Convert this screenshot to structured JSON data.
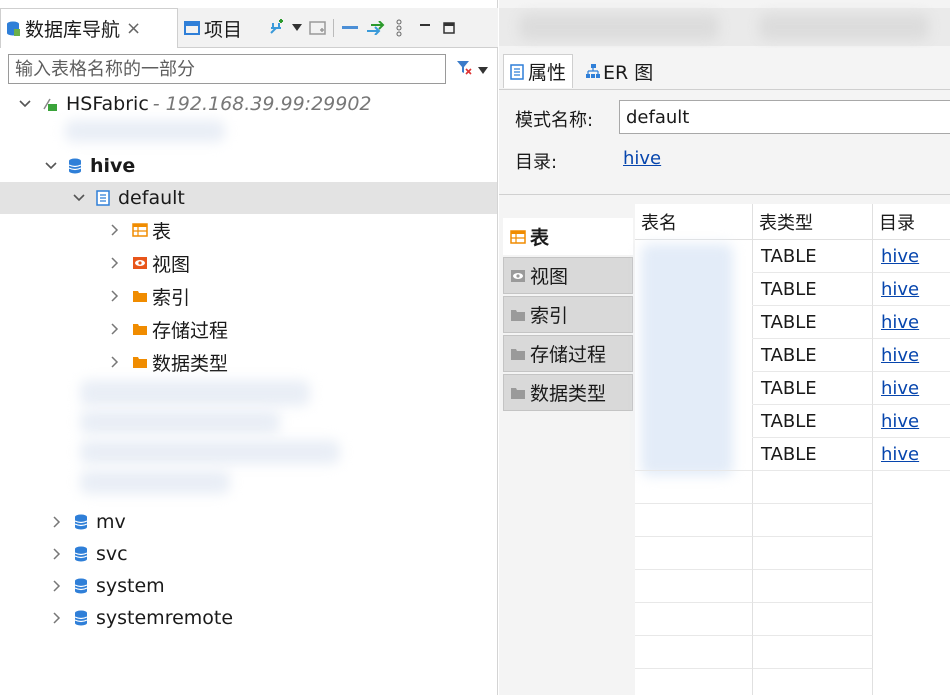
{
  "left_panel": {
    "tabs": [
      {
        "label": "数据库导航",
        "close": "×"
      },
      {
        "label": "项目"
      }
    ],
    "filter": {
      "placeholder": "输入表格名称的一部分"
    },
    "tree": {
      "connection": {
        "name": "HSFabric",
        "detail": " - 192.168.39.99:29902"
      },
      "database": "hive",
      "schema": "default",
      "folders": [
        "表",
        "视图",
        "索引",
        "存储过程",
        "数据类型"
      ],
      "other_databases": [
        "mv",
        "svc",
        "system",
        "systemremote"
      ]
    }
  },
  "right_panel": {
    "tabs": [
      {
        "label": "属性"
      },
      {
        "label": "ER 图"
      }
    ],
    "properties": {
      "schema_label": "模式名称:",
      "schema_value": "default",
      "catalog_label": "目录:",
      "catalog_value": "hive"
    },
    "side_tabs": [
      "表",
      "视图",
      "索引",
      "存储过程",
      "数据类型"
    ],
    "table": {
      "columns": [
        "表名",
        "表类型",
        "目录"
      ],
      "rows": [
        {
          "type": "TABLE",
          "catalog": "hive"
        },
        {
          "type": "TABLE",
          "catalog": "hive"
        },
        {
          "type": "TABLE",
          "catalog": "hive"
        },
        {
          "type": "TABLE",
          "catalog": "hive"
        },
        {
          "type": "TABLE",
          "catalog": "hive"
        },
        {
          "type": "TABLE",
          "catalog": "hive"
        },
        {
          "type": "TABLE",
          "catalog": "hive"
        }
      ]
    }
  },
  "colors": {
    "db_icon": "#2f7fd8",
    "folder": "#f08c00",
    "link": "#0645ad",
    "selection": "#e3e3e3"
  }
}
